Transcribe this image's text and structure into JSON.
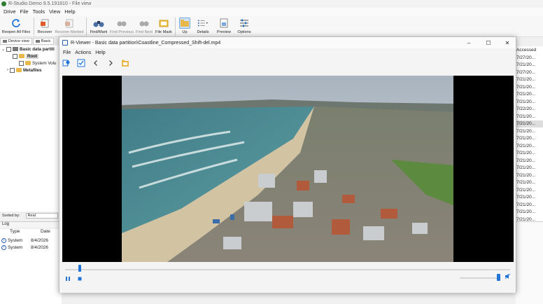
{
  "app": {
    "title": "R-Studio Demo 9.5.191810 - File view"
  },
  "menu": [
    "Drive",
    "File",
    "Tools",
    "View",
    "Help"
  ],
  "toolbar": [
    {
      "label": "Reopen All Files",
      "icon": "refresh-icon",
      "disabled": false
    },
    {
      "label": "Recover",
      "icon": "recover-icon",
      "disabled": false
    },
    {
      "label": "Recover Marked",
      "icon": "recover-marked-icon",
      "disabled": true
    },
    {
      "label": "Find/Mark",
      "icon": "binoculars-icon",
      "disabled": false
    },
    {
      "label": "Find Previous",
      "icon": "find-previous-icon",
      "disabled": true
    },
    {
      "label": "Find Next",
      "icon": "find-next-icon",
      "disabled": true
    },
    {
      "label": "File Mask",
      "icon": "file-mask-icon",
      "disabled": false
    },
    {
      "label": "Up",
      "icon": "folder-up-icon",
      "disabled": false
    },
    {
      "label": "Details",
      "icon": "details-icon",
      "disabled": false
    },
    {
      "label": "Preview",
      "icon": "preview-icon",
      "disabled": false
    },
    {
      "label": "Options",
      "icon": "options-icon",
      "disabled": false
    }
  ],
  "left_tabs": [
    "Device view",
    "Basic"
  ],
  "tree": [
    {
      "label": "Basic data partiti",
      "type": "drive",
      "indent": 0
    },
    {
      "label": "Root",
      "type": "folder",
      "indent": 1
    },
    {
      "label": "System Volu",
      "type": "folder",
      "indent": 2
    },
    {
      "label": "Metafiles",
      "type": "folder",
      "indent": 1
    }
  ],
  "sorted": {
    "label": "Sorted by:",
    "value": "Real"
  },
  "log": {
    "title": "Log",
    "columns": [
      "Type",
      "Date"
    ],
    "rows": [
      {
        "type": "System",
        "date": "8/4/2026"
      },
      {
        "type": "System",
        "date": "8/4/2026"
      }
    ]
  },
  "right_column": {
    "header": "Accessed",
    "cells": [
      "7/27/20...",
      "7/21/20...",
      "7/27/20...",
      "7/21/20...",
      "7/21/20...",
      "7/21/20...",
      "7/21/20...",
      "7/22/20...",
      "7/21/20...",
      "7/21/20...",
      "7/21/20...",
      "7/21/20...",
      "7/21/20...",
      "7/21/20...",
      "7/21/20...",
      "7/21/20...",
      "7/21/20...",
      "7/21/20...",
      "7/21/20...",
      "7/21/20...",
      "7/21/20...",
      "7/21/20...",
      "7/21/20..."
    ],
    "selected_index": 9
  },
  "viewer": {
    "title": "R-Viewer - Basic data partition\\Coastline_Compressed_Shift-del.mp4",
    "menu": [
      "File",
      "Actions",
      "Help"
    ],
    "tools": [
      "location-pin-icon",
      "checkbox-icon",
      "back-arrow-icon",
      "forward-arrow-icon",
      "folder-icon"
    ],
    "playback_progress": 0.03,
    "volume": 1.0
  },
  "colors": {
    "accent": "#1f74d6",
    "folder": "#e8b84a"
  }
}
